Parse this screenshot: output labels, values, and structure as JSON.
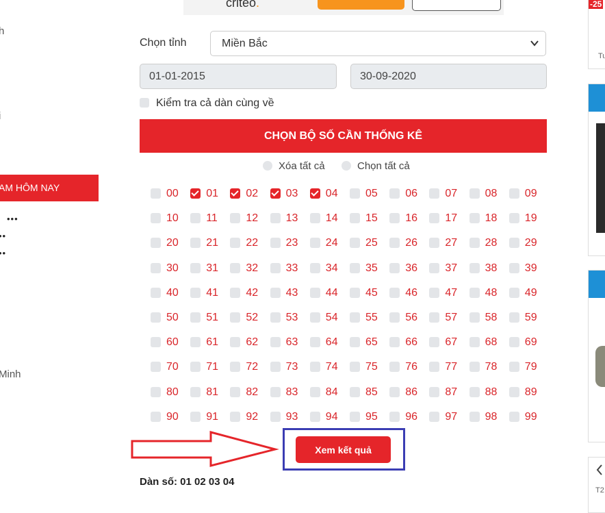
{
  "ad": {
    "brand": "criteo",
    "brand_dot": "."
  },
  "sidebar": {
    "frag1": "h",
    "frag2": "i",
    "section_title": "AM HÔM NAY",
    "dots": [
      "•••",
      "••",
      "••"
    ],
    "frag3": "Minh"
  },
  "form": {
    "province_label": "Chọn tỉnh",
    "province_value": "Miền Bắc",
    "date_from": "01-01-2015",
    "date_to": "30-09-2020",
    "check_all_label": "Kiểm tra cả dàn cùng về"
  },
  "picker": {
    "header": "CHỌN BỘ SỐ CẦN THỐNG KÊ",
    "clear_all": "Xóa tất cả",
    "select_all": "Chọn tất cả",
    "numbers": [
      "00",
      "01",
      "02",
      "03",
      "04",
      "05",
      "06",
      "07",
      "08",
      "09",
      "10",
      "11",
      "12",
      "13",
      "14",
      "15",
      "16",
      "17",
      "18",
      "19",
      "20",
      "21",
      "22",
      "23",
      "24",
      "25",
      "26",
      "27",
      "28",
      "29",
      "30",
      "31",
      "32",
      "33",
      "34",
      "35",
      "36",
      "37",
      "38",
      "39",
      "40",
      "41",
      "42",
      "43",
      "44",
      "45",
      "46",
      "47",
      "48",
      "49",
      "50",
      "51",
      "52",
      "53",
      "54",
      "55",
      "56",
      "57",
      "58",
      "59",
      "60",
      "61",
      "62",
      "63",
      "64",
      "65",
      "66",
      "67",
      "68",
      "69",
      "70",
      "71",
      "72",
      "73",
      "74",
      "75",
      "76",
      "77",
      "78",
      "79",
      "80",
      "81",
      "82",
      "83",
      "84",
      "85",
      "86",
      "87",
      "88",
      "89",
      "90",
      "91",
      "92",
      "93",
      "94",
      "95",
      "96",
      "97",
      "98",
      "99"
    ],
    "selected": [
      "01",
      "02",
      "03",
      "04"
    ]
  },
  "result_button": "Xem kết quả",
  "dan_so": "Dàn số: 01 02 03 04",
  "right_ads": {
    "discount": "-25",
    "frag_tu": "Tu",
    "frag_t2": "T2",
    "prev_icon": "chevron-left-icon"
  },
  "colors": {
    "primary_red": "#e5252a",
    "annotation_red": "#e5252a",
    "annotation_blue": "#3b3db3",
    "accent_blue": "#1e90d6"
  }
}
